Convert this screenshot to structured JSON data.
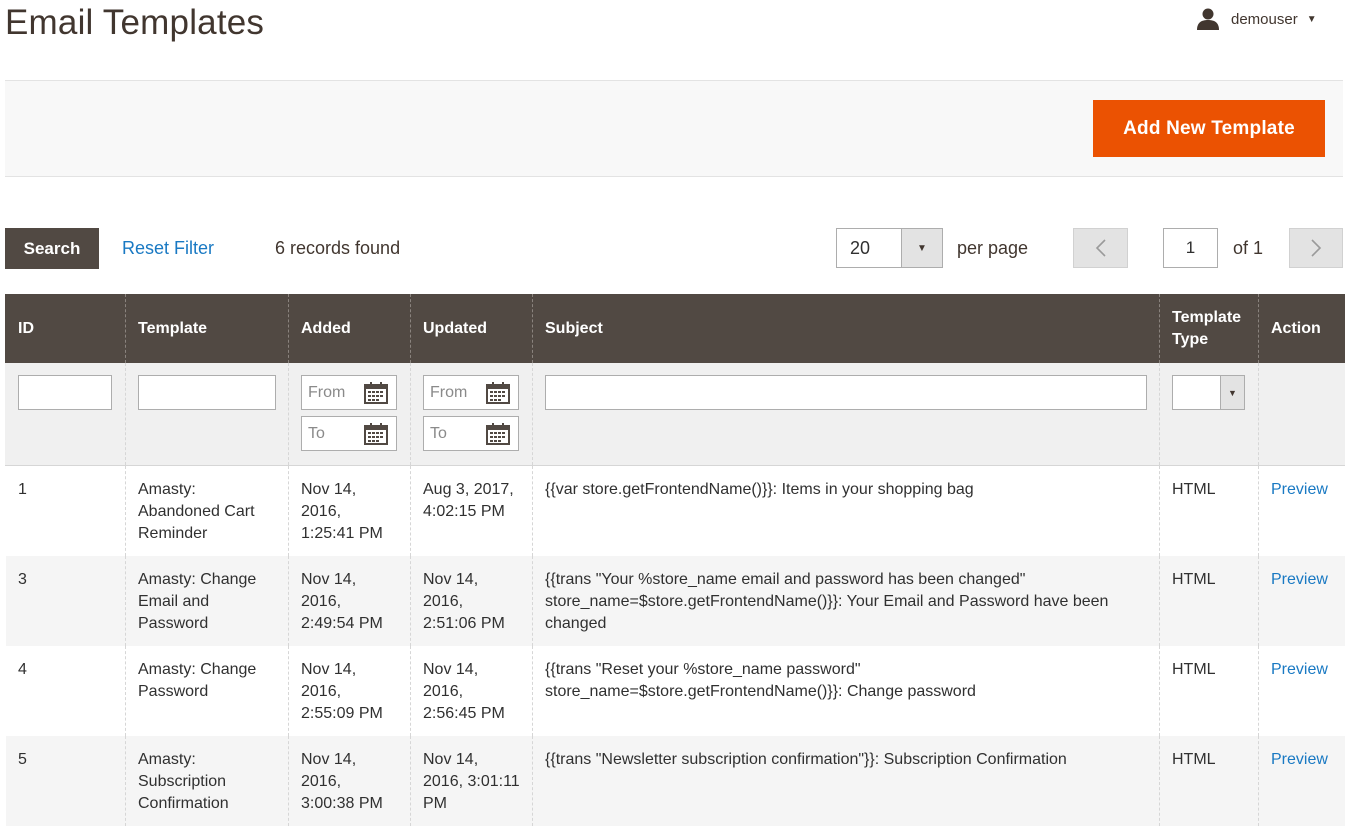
{
  "page": {
    "title": "Email Templates"
  },
  "user": {
    "name": "demouser"
  },
  "actions": {
    "add_new": "Add New Template"
  },
  "grid_controls": {
    "search_label": "Search",
    "reset_filter_label": "Reset Filter",
    "records_found": "6 records found",
    "per_page_value": "20",
    "per_page_label": "per page",
    "current_page": "1",
    "page_total": "of 1"
  },
  "columns": {
    "id": "ID",
    "template": "Template",
    "added": "Added",
    "updated": "Updated",
    "subject": "Subject",
    "type": "Template Type",
    "action": "Action"
  },
  "filters": {
    "from_placeholder": "From",
    "to_placeholder": "To"
  },
  "rows": [
    {
      "id": "1",
      "template": "Amasty: Abandoned Cart Reminder",
      "added": "Nov 14, 2016, 1:25:41 PM",
      "updated": "Aug 3, 2017, 4:02:15 PM",
      "subject": "{{var store.getFrontendName()}}: Items in your shopping bag",
      "type": "HTML",
      "action": "Preview"
    },
    {
      "id": "3",
      "template": "Amasty: Change Email and Password",
      "added": "Nov 14, 2016, 2:49:54 PM",
      "updated": "Nov 14, 2016, 2:51:06 PM",
      "subject": "{{trans \"Your %store_name email and password has been changed\" store_name=$store.getFrontendName()}}: Your Email and Password have been changed",
      "type": "HTML",
      "action": "Preview"
    },
    {
      "id": "4",
      "template": "Amasty: Change Password",
      "added": "Nov 14, 2016, 2:55:09 PM",
      "updated": "Nov 14, 2016, 2:56:45 PM",
      "subject": "{{trans \"Reset your %store_name password\" store_name=$store.getFrontendName()}}: Change password",
      "type": "HTML",
      "action": "Preview"
    },
    {
      "id": "5",
      "template": "Amasty: Subscription Confirmation",
      "added": "Nov 14, 2016, 3:00:38 PM",
      "updated": "Nov 14, 2016, 3:01:11 PM",
      "subject": "{{trans \"Newsletter subscription confirmation\"}}: Subscription Confirmation",
      "type": "HTML",
      "action": "Preview"
    }
  ]
}
